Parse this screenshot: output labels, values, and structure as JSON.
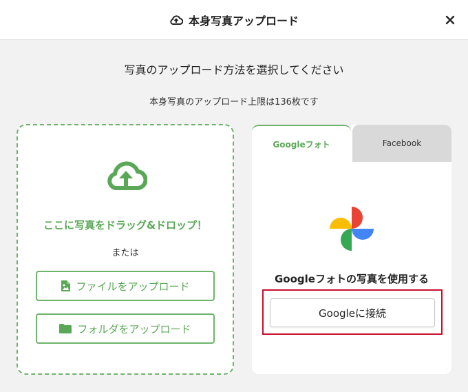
{
  "header": {
    "title": "本身写真アップロード",
    "icon": "cloud-upload-icon"
  },
  "subtitle": "写真のアップロード方法を選択してください",
  "limit_text": "本身写真のアップロード上限は136枚です",
  "drop_zone": {
    "drop_text": "ここに写真をドラッグ&ドロップ！",
    "or_text": "または",
    "file_button": "ファイルをアップロード",
    "folder_button": "フォルダをアップロード"
  },
  "tabs": [
    {
      "label": "Googleフォト",
      "active": true
    },
    {
      "label": "Facebook",
      "active": false
    }
  ],
  "google": {
    "heading": "Googleフォトの写真を使用する",
    "connect_button": "Googleに接続"
  },
  "colors": {
    "accent": "#5aa857",
    "highlight": "#c8102e"
  }
}
